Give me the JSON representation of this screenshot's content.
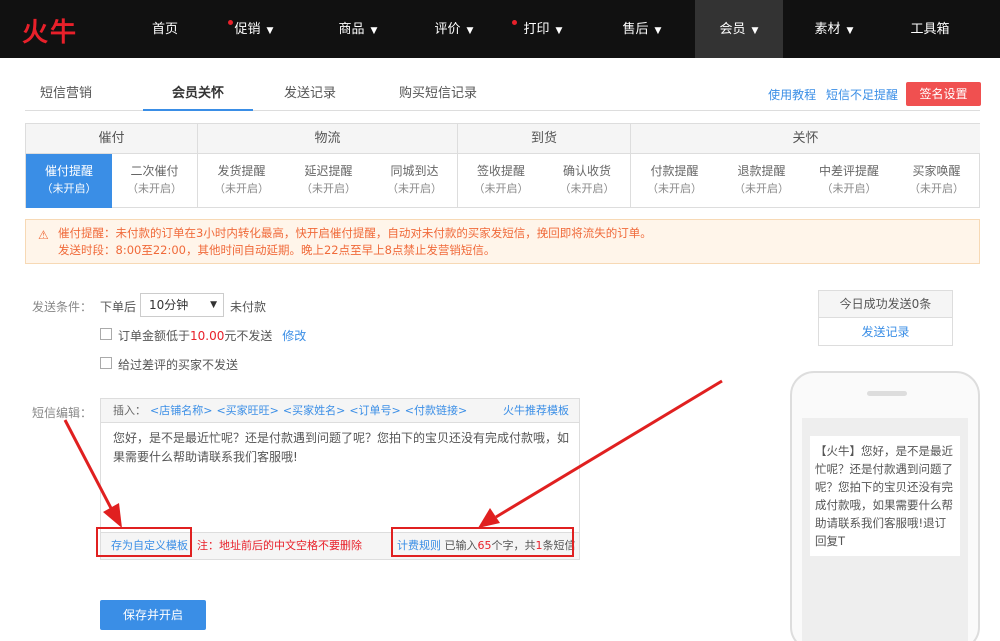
{
  "logo": "火牛",
  "nav": [
    {
      "label": "首页",
      "dot": false,
      "caret": false
    },
    {
      "label": "促销",
      "dot": true,
      "caret": true
    },
    {
      "label": "商品",
      "dot": false,
      "caret": true
    },
    {
      "label": "评价",
      "dot": false,
      "caret": true
    },
    {
      "label": "打印",
      "dot": true,
      "caret": true
    },
    {
      "label": "售后",
      "dot": false,
      "caret": true
    },
    {
      "label": "会员",
      "dot": false,
      "caret": true,
      "active": true
    },
    {
      "label": "素材",
      "dot": false,
      "caret": true
    },
    {
      "label": "工具箱",
      "dot": false,
      "caret": false
    }
  ],
  "tabs": [
    {
      "label": "短信营销"
    },
    {
      "label": "会员关怀",
      "active": true
    },
    {
      "label": "发送记录"
    },
    {
      "label": "购买短信记录"
    }
  ],
  "top_links": {
    "tutorial": "使用教程",
    "remind": "短信不足提醒",
    "sign": "签名设置"
  },
  "categories": [
    {
      "label": "催付"
    },
    {
      "label": "物流"
    },
    {
      "label": "到货"
    },
    {
      "label": "关怀"
    }
  ],
  "items": [
    {
      "label": "催付提醒",
      "status": "（未开启）",
      "active": true
    },
    {
      "label": "二次催付",
      "status": "（未开启）"
    },
    {
      "label": "发货提醒",
      "status": "（未开启）"
    },
    {
      "label": "延迟提醒",
      "status": "（未开启）"
    },
    {
      "label": "同城到达",
      "status": "（未开启）"
    },
    {
      "label": "签收提醒",
      "status": "（未开启）"
    },
    {
      "label": "确认收货",
      "status": "（未开启）"
    },
    {
      "label": "付款提醒",
      "status": "（未开启）"
    },
    {
      "label": "退款提醒",
      "status": "（未开启）"
    },
    {
      "label": "中差评提醒",
      "status": "（未开启）"
    },
    {
      "label": "买家唤醒",
      "status": "（未开启）"
    }
  ],
  "warning": {
    "line1": "催付提醒：未付款的订单在3小时内转化最高，快开启催付提醒，自动对未付款的买家发短信，挽回即将流失的订单。",
    "line2": "发送时段：8:00至22:00，其他时间自动延期。晚上22点至早上8点禁止发营销短信。"
  },
  "form": {
    "cond_label": "发送条件：",
    "after_order": "下单后",
    "delay": "10分钟",
    "unpaid": "未付款",
    "amount_prefix": "订单金额低于",
    "amount_value": "10.00",
    "amount_suffix": "元不发送",
    "modify": "修改",
    "no_bad": "给过差评的买家不发送",
    "sms_label": "短信编辑："
  },
  "editor": {
    "insert_label": "插入：",
    "inserts": [
      "<店铺名称>",
      "<买家旺旺>",
      "<买家姓名>",
      "<订单号>",
      "<付款链接>"
    ],
    "recommend": "火牛推荐模板",
    "content": "您好，是不是最近忙呢？还是付款遇到问题了呢？您拍下的宝贝还没有完成付款哦，如果需要什么帮助请联系我们客服哦!",
    "save_template": "存为自定义模板",
    "note": "注：地址前后的中文空格不要删除",
    "billing": "计费规则",
    "count_prefix": "已输入",
    "count_value": "65",
    "count_mid": "个字，共",
    "sms_count": "1",
    "count_suffix": "条短信"
  },
  "stats": {
    "today": "今日成功发送0条",
    "record": "发送记录"
  },
  "preview": "【火牛】您好，是不是最近忙呢？还是付款遇到问题了呢？您拍下的宝贝还没有完成付款哦，如果需要什么帮助请联系我们客服哦!退订回复T",
  "save_button": "保存并开启",
  "colors": {
    "accent": "#3a8ee6",
    "brand": "#e8202a",
    "warning": "#f06a3a"
  }
}
